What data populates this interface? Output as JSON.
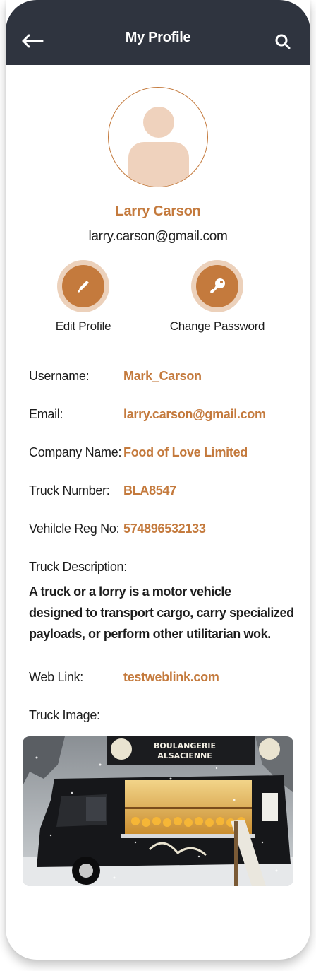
{
  "header": {
    "title": "My Profile",
    "back_icon": "arrow-left-icon",
    "search_icon": "search-icon",
    "background": "#2f343f"
  },
  "profile": {
    "name": "Larry Carson",
    "email": "larry.carson@gmail.com"
  },
  "actions": {
    "edit_label": "Edit Profile",
    "edit_icon": "pencil-icon",
    "change_password_label": "Change Password",
    "change_password_icon": "key-icon"
  },
  "details": {
    "username_label": "Username:",
    "username_value": "Mark_Carson",
    "email_label": "Email:",
    "email_value": "larry.carson@gmail.com",
    "company_label": "Company Name:",
    "company_value": "Food of Love Limited",
    "truck_number_label": "Truck Number:",
    "truck_number_value": "BLA8547",
    "vehicle_reg_label": "Vehilcle Reg No:",
    "vehicle_reg_value": "574896532133",
    "description_label": "Truck Description:",
    "description_line1": "A truck or a lorry is a motor vehicle",
    "description_line2": "designed to transport cargo, carry specialized",
    "description_line3": "payloads, or perform other utilitarian wok.",
    "weblink_label": "Web Link:",
    "weblink_value": "testweblink.com",
    "truck_image_label": "Truck Image:"
  },
  "truck_image": {
    "sign_line1": "BOULANGERIE",
    "sign_line2": "ALSACIENNE"
  },
  "colors": {
    "accent": "#c47a3d",
    "accent_light": "#ecd1bb",
    "text": "#1d1d1d"
  }
}
